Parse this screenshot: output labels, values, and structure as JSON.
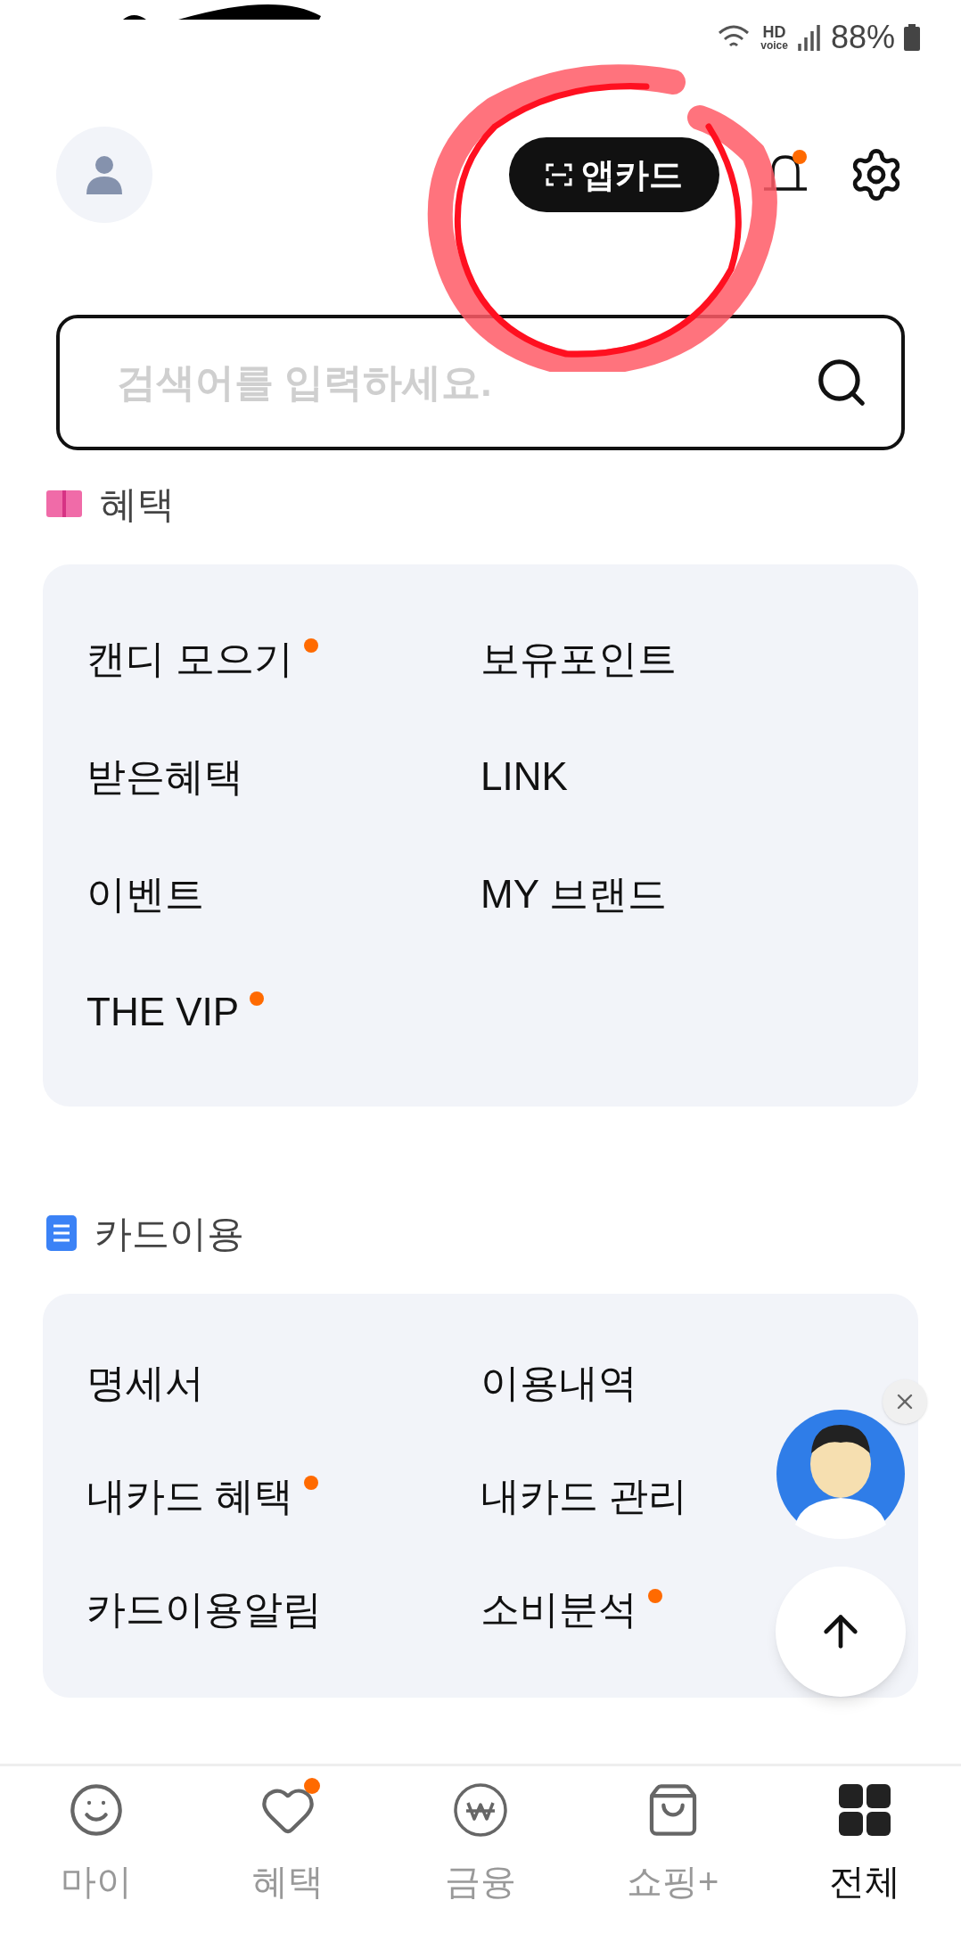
{
  "status_bar": {
    "battery": "88%",
    "hd_label": "HD",
    "voice_label": "voice"
  },
  "header": {
    "app_card_button": "앱카드",
    "notification_badge": true
  },
  "search": {
    "placeholder": "검색어를 입력하세요."
  },
  "sections": [
    {
      "title": "혜택",
      "kind": "gift",
      "items": [
        {
          "label": "캔디 모으기",
          "new": true
        },
        {
          "label": "보유포인트",
          "new": false
        },
        {
          "label": "받은혜택",
          "new": false
        },
        {
          "label": "LINK",
          "new": false
        },
        {
          "label": "이벤트",
          "new": false
        },
        {
          "label": "MY 브랜드",
          "new": false
        },
        {
          "label": "THE VIP",
          "new": true
        }
      ]
    },
    {
      "title": "카드이용",
      "kind": "document",
      "items": [
        {
          "label": "명세서",
          "new": false
        },
        {
          "label": "이용내역",
          "new": false
        },
        {
          "label": "내카드 혜택",
          "new": true
        },
        {
          "label": "내카드 관리",
          "new": false
        },
        {
          "label": "카드이용알림",
          "new": false
        },
        {
          "label": "소비분석",
          "new": true
        }
      ]
    }
  ],
  "bottom_nav": [
    {
      "label": "마이",
      "kind": "smile",
      "selected": false,
      "badge": false
    },
    {
      "label": "혜택",
      "kind": "heart",
      "selected": false,
      "badge": true
    },
    {
      "label": "금융",
      "kind": "won",
      "selected": false,
      "badge": false
    },
    {
      "label": "쇼핑+",
      "kind": "bag",
      "selected": false,
      "badge": false
    },
    {
      "label": "전체",
      "kind": "grid",
      "selected": true,
      "badge": false
    }
  ],
  "annotation": {
    "kind": "circle"
  }
}
